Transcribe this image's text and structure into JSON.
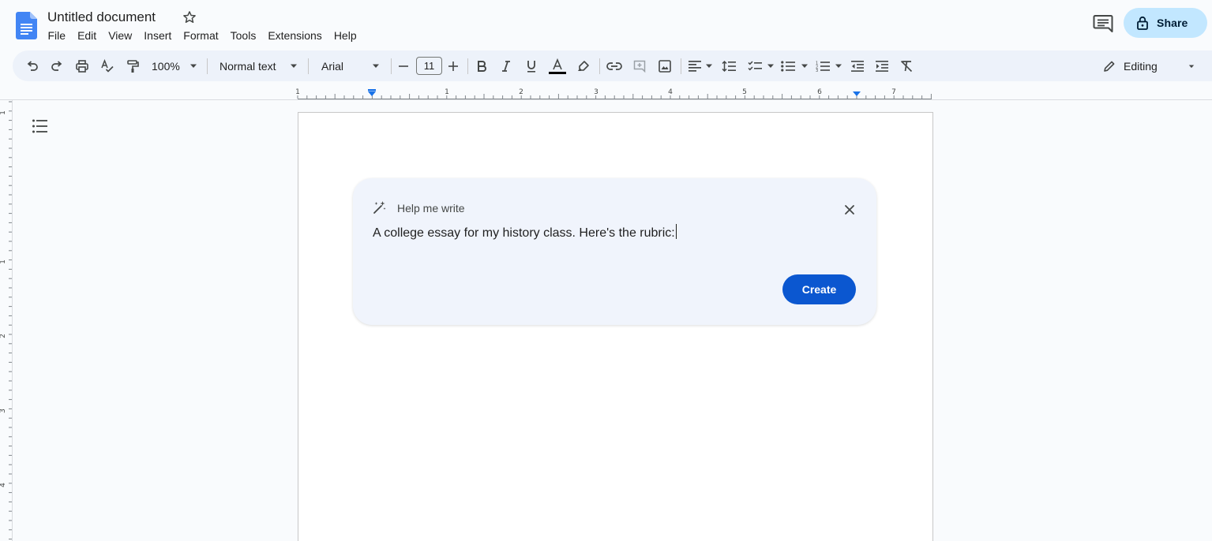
{
  "app": {
    "doc_title": "Untitled document",
    "menu": [
      "File",
      "Edit",
      "View",
      "Insert",
      "Format",
      "Tools",
      "Extensions",
      "Help"
    ],
    "share_label": "Share"
  },
  "toolbar": {
    "zoom": "100%",
    "style": "Normal text",
    "font": "Arial",
    "font_size": "11",
    "mode": "Editing"
  },
  "ruler": {
    "marks": [
      "1",
      "1",
      "2",
      "3",
      "4",
      "5",
      "6",
      "7"
    ],
    "left_marks": [
      "1",
      "1",
      "2",
      "3",
      "4"
    ]
  },
  "help_me_write": {
    "title": "Help me write",
    "prompt": "A college essay for my history class. Here's the rubric:",
    "create_label": "Create"
  },
  "colors": {
    "accent": "#0b57d0",
    "share_bg": "#c2e7ff",
    "toolbar_bg": "#edf2fa",
    "card_bg": "#f0f4fc"
  }
}
